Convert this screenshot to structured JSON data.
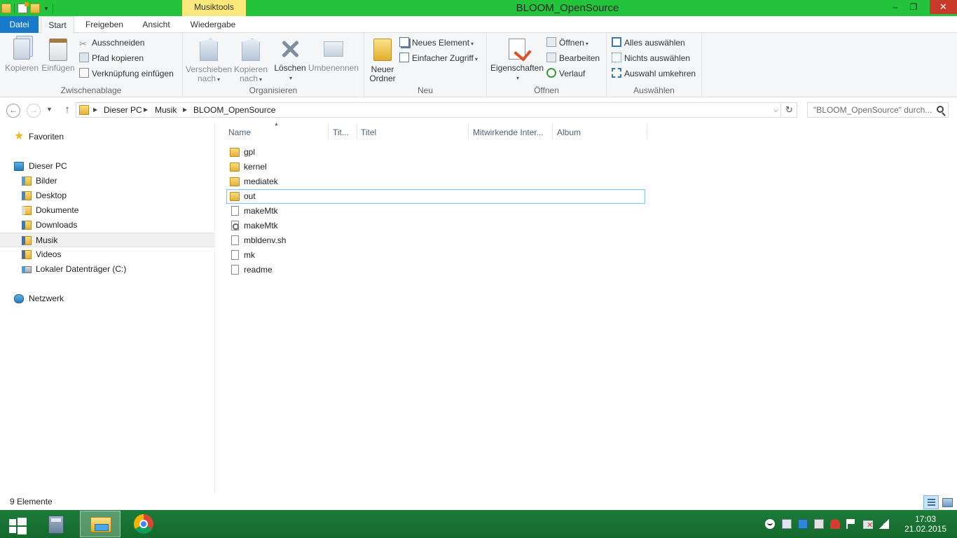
{
  "window": {
    "title": "BLOOM_OpenSource",
    "contextual_tab": "Musiktools",
    "minimize": "–",
    "maximize": "❐",
    "close": "✕"
  },
  "ribbon_tabs": {
    "file": "Datei",
    "start": "Start",
    "share": "Freigeben",
    "view": "Ansicht",
    "play": "Wiedergabe"
  },
  "ribbon": {
    "clipboard": {
      "label": "Zwischenablage",
      "copy": "Kopieren",
      "paste": "Einfügen",
      "cut": "Ausschneiden",
      "copy_path": "Pfad kopieren",
      "paste_shortcut": "Verknüpfung einfügen"
    },
    "organize": {
      "label": "Organisieren",
      "move_to_1": "Verschieben",
      "move_to_2": "nach",
      "copy_to_1": "Kopieren",
      "copy_to_2": "nach",
      "delete": "Löschen",
      "rename": "Umbenennen"
    },
    "new": {
      "label": "Neu",
      "new_folder_1": "Neuer",
      "new_folder_2": "Ordner",
      "new_item": "Neues Element",
      "easy_access": "Einfacher Zugriff"
    },
    "open": {
      "label": "Öffnen",
      "properties": "Eigenschaften",
      "open": "Öffnen",
      "edit": "Bearbeiten",
      "history": "Verlauf"
    },
    "select": {
      "label": "Auswählen",
      "select_all": "Alles auswählen",
      "select_none": "Nichts auswählen",
      "invert": "Auswahl umkehren"
    }
  },
  "address": {
    "crumbs": [
      "Dieser PC",
      "Musik",
      "BLOOM_OpenSource"
    ],
    "search_placeholder": "\"BLOOM_OpenSource\" durch..."
  },
  "nav_pane": {
    "favorites": "Favoriten",
    "this_pc": "Dieser PC",
    "items": [
      "Bilder",
      "Desktop",
      "Dokumente",
      "Downloads",
      "Musik",
      "Videos",
      "Lokaler Datenträger (C:)"
    ],
    "network": "Netzwerk",
    "selected": "Musik"
  },
  "columns": {
    "name": "Name",
    "track": "Tit...",
    "title": "Titel",
    "artist": "Mitwirkende Inter...",
    "album": "Album"
  },
  "files": [
    {
      "name": "gpl",
      "type": "folder"
    },
    {
      "name": "kernel",
      "type": "folder"
    },
    {
      "name": "mediatek",
      "type": "folder"
    },
    {
      "name": "out",
      "type": "folder",
      "selected": true
    },
    {
      "name": "makeMtk",
      "type": "file"
    },
    {
      "name": "makeMtk",
      "type": "settings-file"
    },
    {
      "name": "mbldenv.sh",
      "type": "file"
    },
    {
      "name": "mk",
      "type": "file"
    },
    {
      "name": "readme",
      "type": "file"
    }
  ],
  "status": {
    "item_count": "9 Elemente"
  },
  "taskbar": {
    "time": "17:03",
    "date": "21.02.2015"
  }
}
